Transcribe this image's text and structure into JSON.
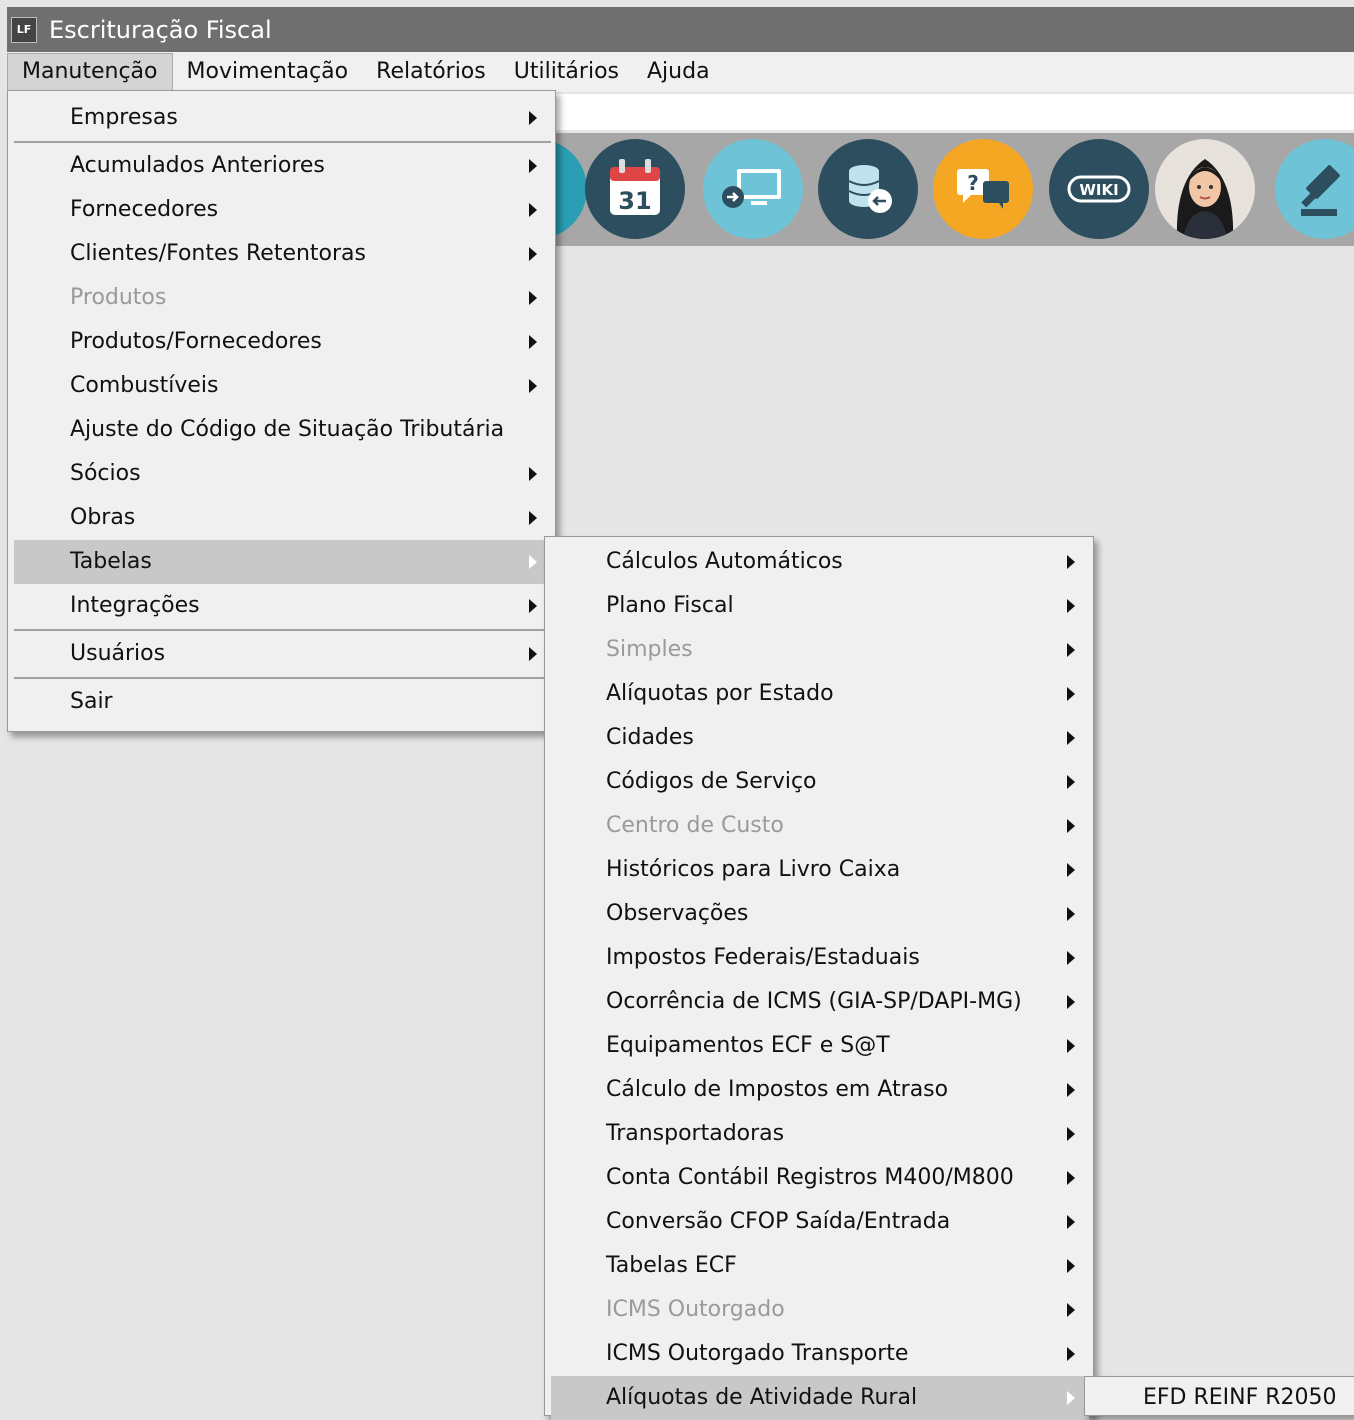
{
  "window": {
    "title": "Escrituração Fiscal",
    "icon_text": "LF"
  },
  "menubar": {
    "items": [
      "Manutenção",
      "Movimentação",
      "Relatórios",
      "Utilitários",
      "Ajuda"
    ]
  },
  "toolbar": {
    "calendar_day": "31",
    "wiki_label": "WIKI",
    "help_label": "?"
  },
  "main_menu": {
    "items": [
      {
        "label": "Empresas"
      },
      {
        "label": "Acumulados Anteriores"
      },
      {
        "label": "Fornecedores"
      },
      {
        "label": "Clientes/Fontes Retentoras"
      },
      {
        "label": "Produtos"
      },
      {
        "label": "Produtos/Fornecedores"
      },
      {
        "label": "Combustíveis"
      },
      {
        "label": "Ajuste do Código de Situação Tributária"
      },
      {
        "label": "Sócios"
      },
      {
        "label": "Obras"
      },
      {
        "label": "Tabelas"
      },
      {
        "label": "Integrações"
      },
      {
        "label": "Usuários"
      },
      {
        "label": "Sair"
      }
    ]
  },
  "tabelas_menu": {
    "items": [
      {
        "label": "Cálculos Automáticos"
      },
      {
        "label": "Plano Fiscal"
      },
      {
        "label": "Simples"
      },
      {
        "label": "Alíquotas por Estado"
      },
      {
        "label": "Cidades"
      },
      {
        "label": "Códigos de Serviço"
      },
      {
        "label": "Centro de Custo"
      },
      {
        "label": "Históricos para Livro Caixa"
      },
      {
        "label": "Observações"
      },
      {
        "label": "Impostos Federais/Estaduais"
      },
      {
        "label": "Ocorrência de ICMS (GIA-SP/DAPI-MG)"
      },
      {
        "label": "Equipamentos ECF e S@T"
      },
      {
        "label": "Cálculo de Impostos em Atraso"
      },
      {
        "label": "Transportadoras"
      },
      {
        "label": "Conta Contábil Registros M400/M800"
      },
      {
        "label": "Conversão CFOP Saída/Entrada"
      },
      {
        "label": "Tabelas ECF"
      },
      {
        "label": "ICMS Outorgado"
      },
      {
        "label": "ICMS Outorgado Transporte"
      },
      {
        "label": "Alíquotas de Atividade Rural"
      }
    ]
  },
  "rural_menu": {
    "items": [
      {
        "label": "EFD REINF R2050"
      }
    ]
  }
}
